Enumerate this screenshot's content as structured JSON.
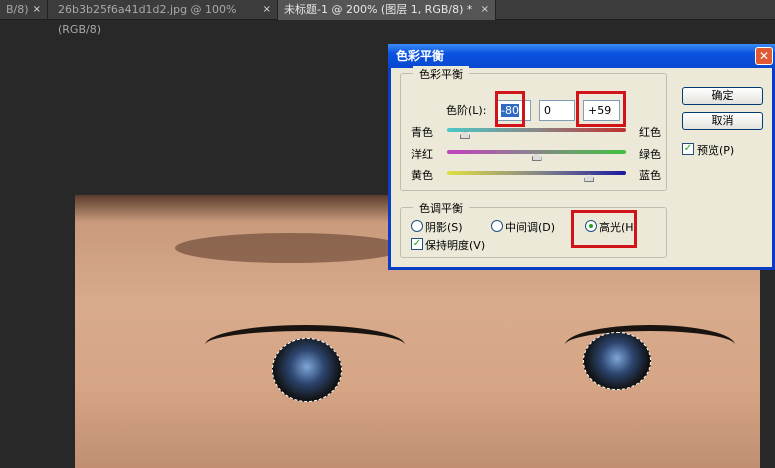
{
  "tabs": [
    {
      "label": "B/8)",
      "close": "×"
    },
    {
      "label": "26b3b25f6a41d1d2.jpg @ 100%(RGB/8)",
      "close": "×"
    },
    {
      "label": "未标题-1 @ 200% (图层 1, RGB/8) *",
      "close": "×",
      "active": true
    }
  ],
  "dialog": {
    "title": "色彩平衡",
    "close": "✕",
    "color_balance": {
      "group_label": "色彩平衡",
      "levels_label": "色阶(L):",
      "levels": [
        "-80",
        "0",
        "+59"
      ],
      "sliders": [
        {
          "left": "青色",
          "right": "红色",
          "value": -80,
          "colors": [
            "#4cc8c8",
            "#c03030"
          ]
        },
        {
          "left": "洋红",
          "right": "绿色",
          "value": 0,
          "colors": [
            "#c040c0",
            "#40c040"
          ]
        },
        {
          "left": "黄色",
          "right": "蓝色",
          "value": 59,
          "colors": [
            "#e0e040",
            "#1a1aa0"
          ]
        }
      ],
      "range": [
        -100,
        100
      ]
    },
    "tone_balance": {
      "group_label": "色调平衡",
      "shadows": "阴影(S)",
      "midtones": "中间调(D)",
      "highlights": "高光(H)",
      "selected": "highlights",
      "preserve_luminosity": "保持明度(V)",
      "preserve_checked": true
    },
    "ok": "确定",
    "cancel": "取消",
    "preview": "预览(P)",
    "preview_checked": true,
    "check_mark": "✓"
  }
}
